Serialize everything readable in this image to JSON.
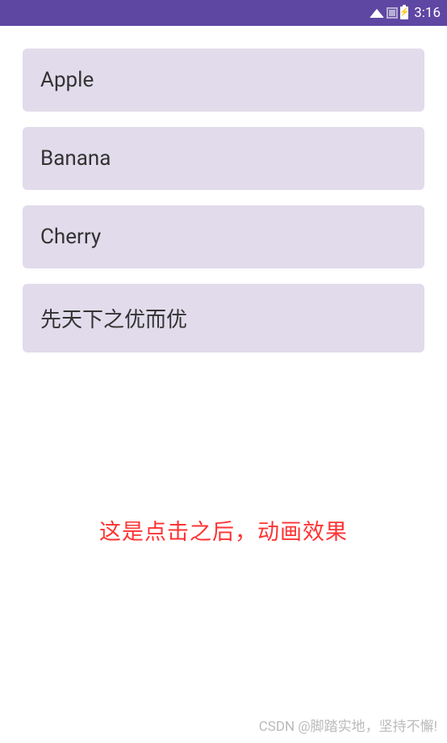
{
  "statusBar": {
    "time": "3:16"
  },
  "list": {
    "items": [
      {
        "label": "Apple"
      },
      {
        "label": "Banana"
      },
      {
        "label": "Cherry"
      },
      {
        "label": "先天下之优而优"
      }
    ]
  },
  "caption": "这是点击之后，动画效果",
  "watermark": "CSDN @脚踏实地，坚持不懈!"
}
